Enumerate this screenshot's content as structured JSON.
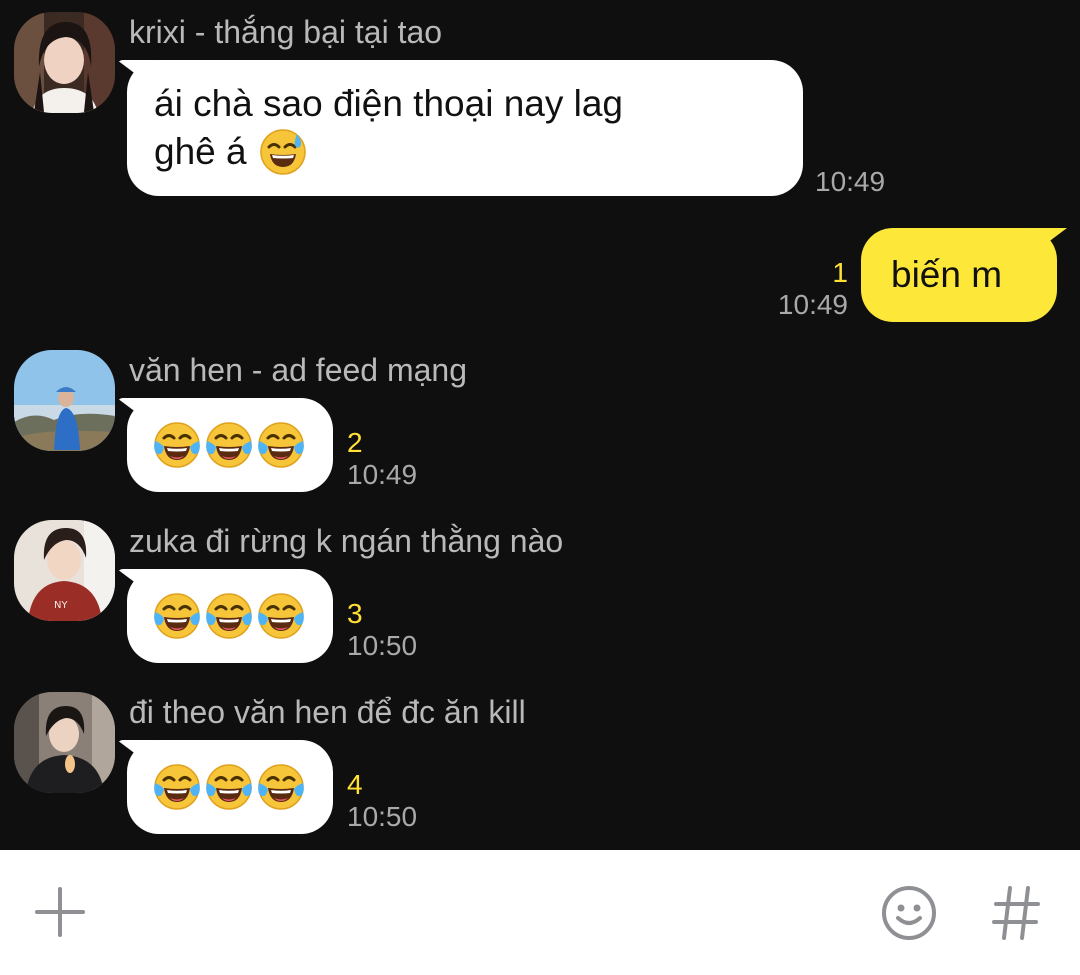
{
  "messages": [
    {
      "sender": "krixi - thắng bại tại tao",
      "text_line1": "ái chà sao điện thoại nay lag",
      "text_line2": "ghê á",
      "emoji": "sweat-smile-emoji",
      "time": "10:49",
      "direction": "incoming"
    },
    {
      "text": "biến m",
      "unread_count": "1",
      "time": "10:49",
      "direction": "outgoing"
    },
    {
      "sender": "văn hen - ad feed mạng",
      "emoji": "tears-of-joy-emoji x3",
      "unread_count": "2",
      "time": "10:49",
      "direction": "incoming"
    },
    {
      "sender": "zuka đi rừng k ngán thằng nào",
      "emoji": "tears-of-joy-emoji x3",
      "unread_count": "3",
      "time": "10:50",
      "direction": "incoming"
    },
    {
      "sender": "đi theo văn hen để đc ăn kill",
      "emoji": "tears-of-joy-emoji x3",
      "unread_count": "4",
      "time": "10:50",
      "direction": "incoming"
    }
  ],
  "input_bar": {
    "icons": [
      "plus-icon",
      "smiley-icon",
      "hashtag-icon"
    ]
  },
  "colors": {
    "background": "#0f0f10",
    "incoming_bubble": "#ffffff",
    "outgoing_bubble": "#fde83a",
    "unread_count": "#ffe033",
    "timestamp": "#a9a9a9",
    "sender_name": "#b9b9b9"
  }
}
